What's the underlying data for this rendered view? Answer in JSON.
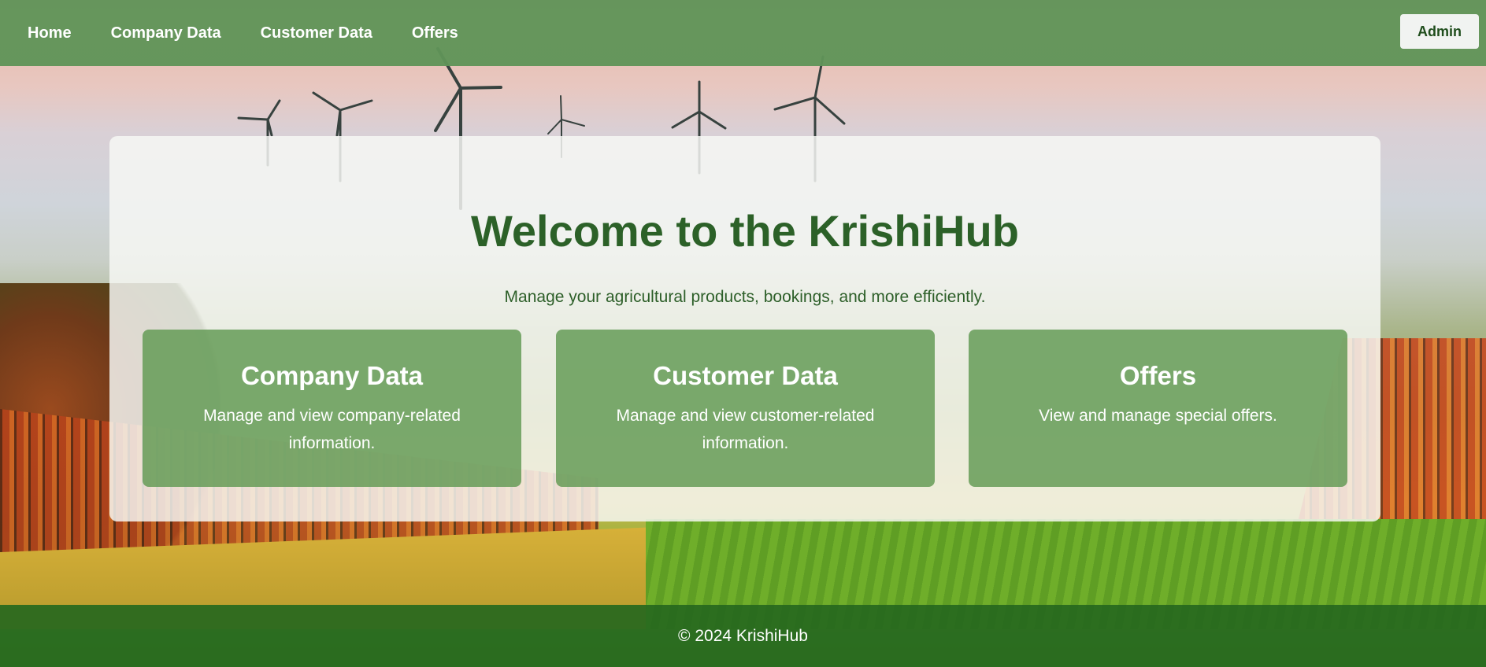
{
  "nav": {
    "links": [
      "Home",
      "Company Data",
      "Customer Data",
      "Offers"
    ],
    "admin_label": "Admin"
  },
  "hero": {
    "title": "Welcome to the KrishiHub",
    "subtitle": "Manage your agricultural products, bookings, and more efficiently."
  },
  "cards": [
    {
      "title": "Company Data",
      "description": "Manage and view company-related information."
    },
    {
      "title": "Customer Data",
      "description": "Manage and view customer-related information."
    },
    {
      "title": "Offers",
      "description": "View and manage special offers."
    }
  ],
  "footer": {
    "text": "© 2024 KrishiHub"
  },
  "colors": {
    "navbar": "#609458",
    "title_green": "#2c6128",
    "card_green": "#609952",
    "footer_green": "#26681e"
  }
}
